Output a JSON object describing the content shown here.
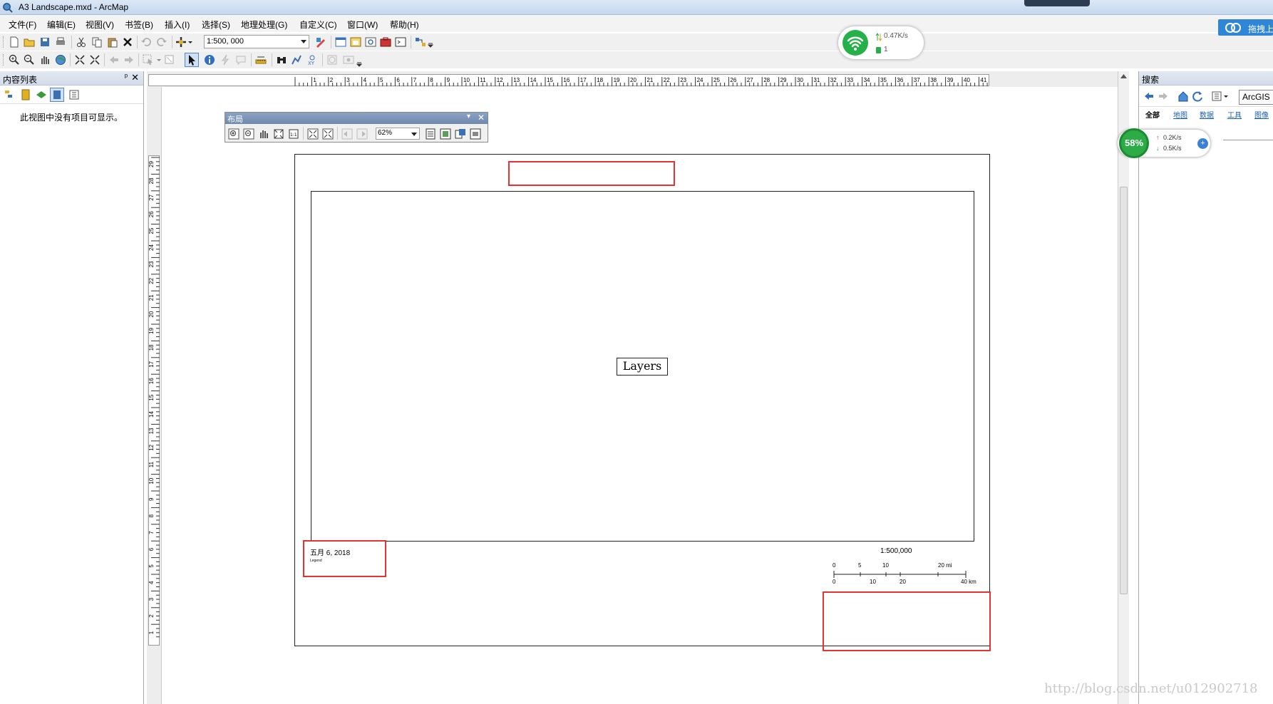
{
  "window": {
    "title": "A3 Landscape.mxd - ArcMap"
  },
  "menu": [
    "文件(F)",
    "编辑(E)",
    "视图(V)",
    "书签(B)",
    "插入(I)",
    "选择(S)",
    "地理处理(G)",
    "自定义(C)",
    "窗口(W)",
    "帮助(H)"
  ],
  "toolbar": {
    "scale": "1:500, 000"
  },
  "net_widget": {
    "speed": "0.47K/s",
    "count": "1"
  },
  "cloud_button": {
    "label": "拖拽上"
  },
  "toc": {
    "title": "内容列表",
    "pin": "ᵖ",
    "empty_message": "此视图中没有项目可显示。"
  },
  "layout_toolbar": {
    "title": "布局",
    "zoom": "62%"
  },
  "layout": {
    "layers_label": "Layers",
    "date": "五月 6, 2018",
    "legend": "Legend",
    "scale_text": "1:500,000",
    "scalebar_top": [
      "0",
      "5",
      "10",
      "20 mi"
    ],
    "scalebar_bottom": [
      "0",
      "10",
      "20",
      "40 km"
    ],
    "ruler_h": [
      "1",
      "2",
      "3",
      "4",
      "5",
      "6",
      "7",
      "8",
      "9",
      "10",
      "11",
      "12",
      "13",
      "14",
      "15",
      "16",
      "17",
      "18",
      "19",
      "20",
      "21",
      "22",
      "23",
      "24",
      "25",
      "26",
      "27",
      "28",
      "29",
      "30",
      "31",
      "32",
      "33",
      "34",
      "35",
      "36",
      "37",
      "38",
      "39",
      "40",
      "41"
    ],
    "ruler_v": [
      "29",
      "28",
      "27",
      "26",
      "25",
      "24",
      "23",
      "22",
      "21",
      "20",
      "19",
      "18",
      "17",
      "16",
      "15",
      "14",
      "13",
      "12",
      "11",
      "10",
      "9",
      "8",
      "7",
      "6",
      "5",
      "4",
      "3",
      "2",
      "1"
    ]
  },
  "search": {
    "title": "搜索",
    "scope_button": "ArcGIS",
    "tabs": [
      "全部",
      "地图",
      "数据",
      "工具",
      "图像"
    ]
  },
  "speed_widget": {
    "percent": "58%",
    "up": "0.2K/s",
    "down": "0.5K/s",
    "plus": "+"
  },
  "watermark": "http://blog.csdn.net/u012902718",
  "colors": {
    "highlight_red": "#e53333",
    "title_blue": "#c5d7ee",
    "accent_green": "#25b04a"
  }
}
